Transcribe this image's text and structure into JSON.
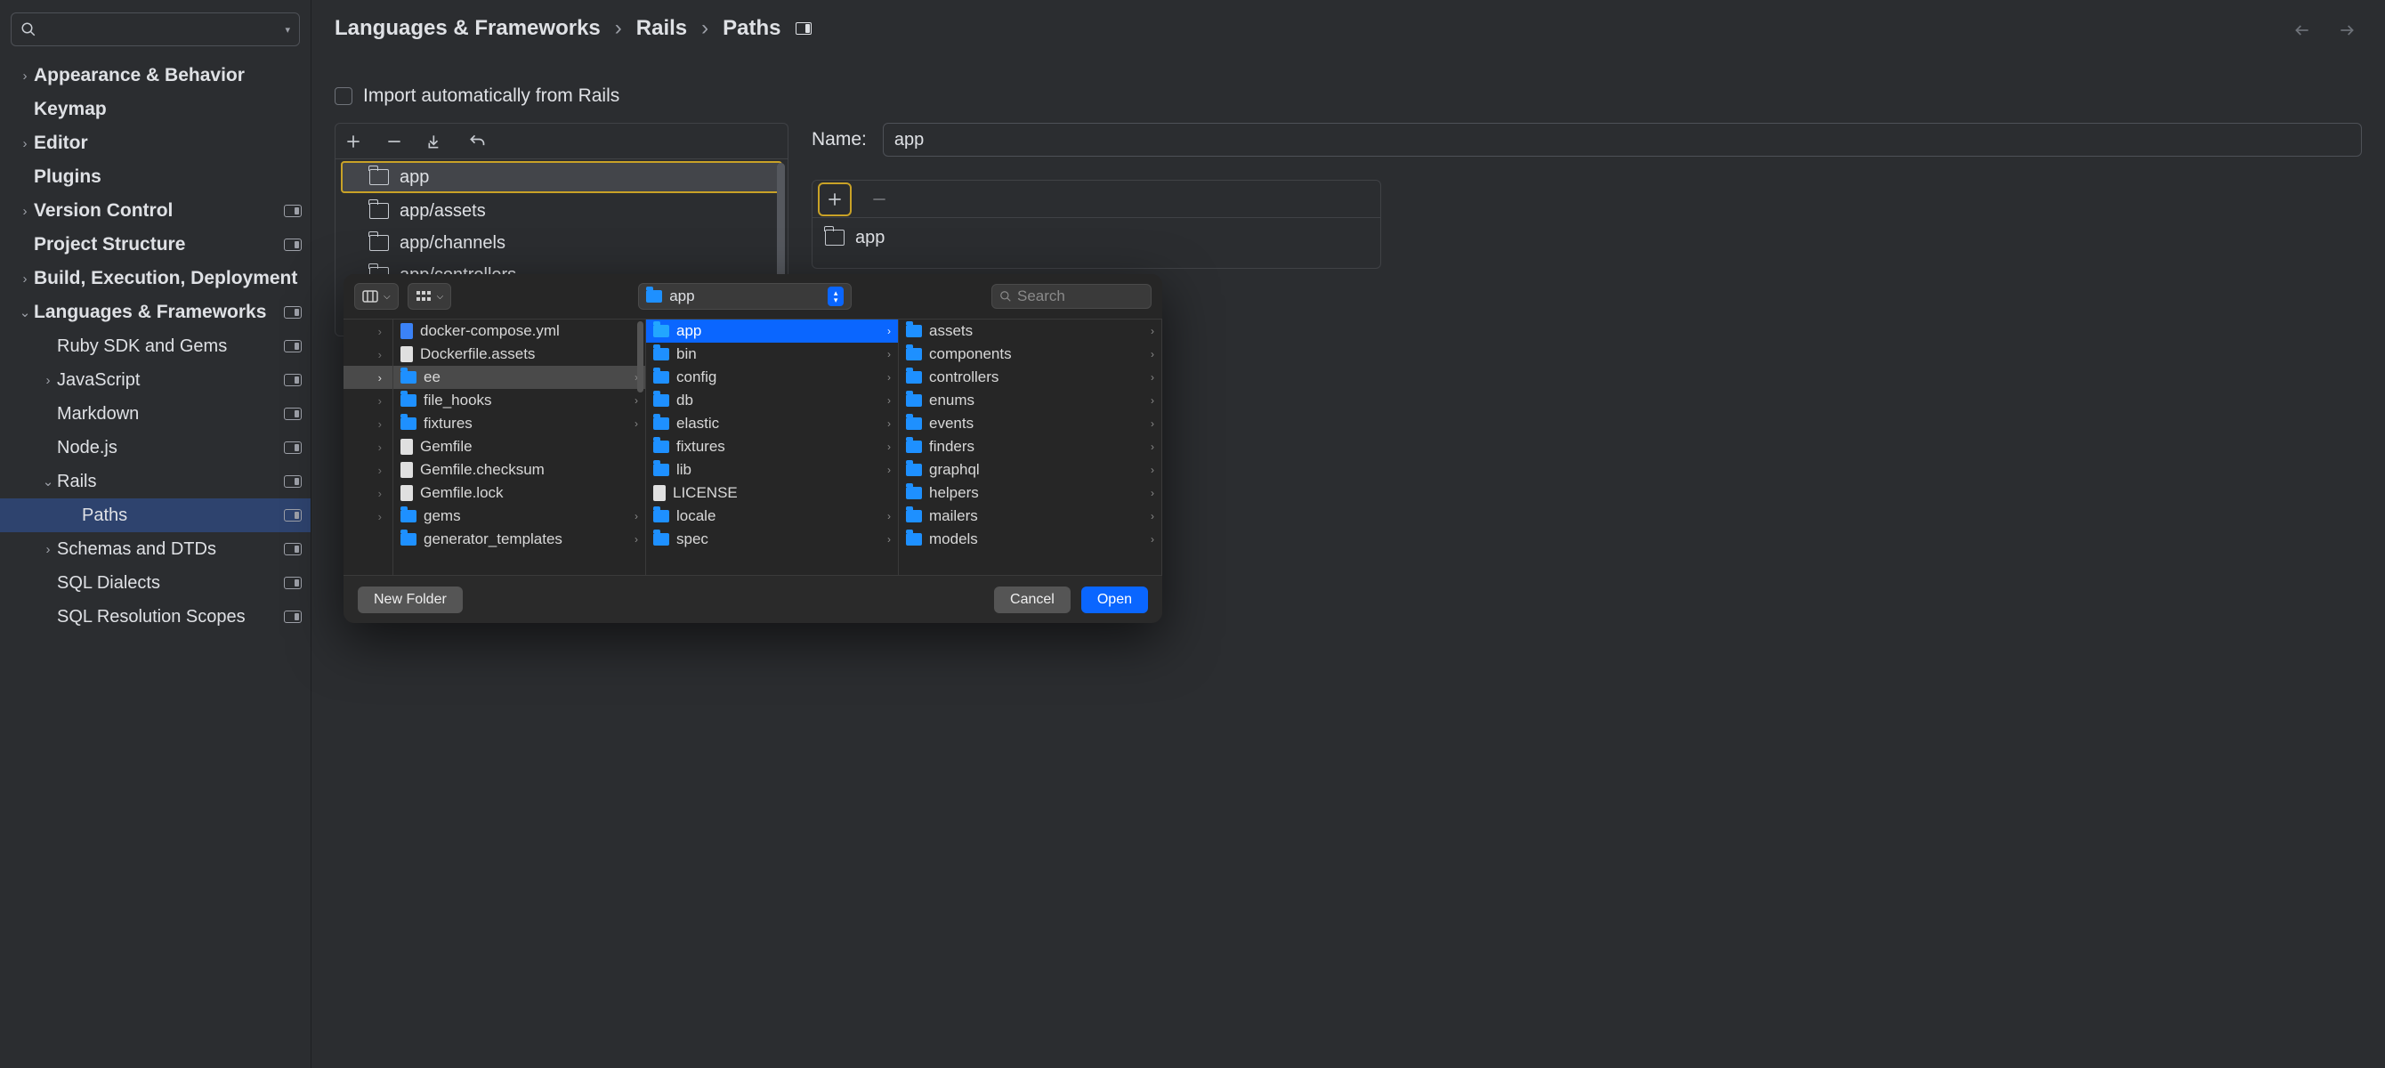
{
  "search": {
    "placeholder": ""
  },
  "sidebar": {
    "items": [
      {
        "label": "Appearance & Behavior",
        "indent": 0,
        "arrow": "right",
        "badge": false
      },
      {
        "label": "Keymap",
        "indent": 0,
        "arrow": "",
        "badge": false
      },
      {
        "label": "Editor",
        "indent": 0,
        "arrow": "right",
        "badge": false
      },
      {
        "label": "Plugins",
        "indent": 0,
        "arrow": "",
        "badge": false
      },
      {
        "label": "Version Control",
        "indent": 0,
        "arrow": "right",
        "badge": true
      },
      {
        "label": "Project Structure",
        "indent": 0,
        "arrow": "",
        "badge": true
      },
      {
        "label": "Build, Execution, Deployment",
        "indent": 0,
        "arrow": "right",
        "badge": false
      },
      {
        "label": "Languages & Frameworks",
        "indent": 0,
        "arrow": "down",
        "badge": true
      },
      {
        "label": "Ruby SDK and Gems",
        "indent": 1,
        "arrow": "",
        "badge": true
      },
      {
        "label": "JavaScript",
        "indent": 1,
        "arrow": "right",
        "badge": true
      },
      {
        "label": "Markdown",
        "indent": 1,
        "arrow": "",
        "badge": true
      },
      {
        "label": "Node.js",
        "indent": 1,
        "arrow": "",
        "badge": true
      },
      {
        "label": "Rails",
        "indent": 1,
        "arrow": "down",
        "badge": true
      },
      {
        "label": "Paths",
        "indent": 2,
        "arrow": "",
        "badge": true,
        "selected": true
      },
      {
        "label": "Schemas and DTDs",
        "indent": 1,
        "arrow": "right",
        "badge": true
      },
      {
        "label": "SQL Dialects",
        "indent": 1,
        "arrow": "",
        "badge": true
      },
      {
        "label": "SQL Resolution Scopes",
        "indent": 1,
        "arrow": "",
        "badge": true
      }
    ]
  },
  "breadcrumb": {
    "a": "Languages & Frameworks",
    "b": "Rails",
    "c": "Paths"
  },
  "import_checkbox_label": "Import automatically from Rails",
  "path_list": [
    {
      "name": "app",
      "selected": true
    },
    {
      "name": "app/assets"
    },
    {
      "name": "app/channels"
    },
    {
      "name": "app/controllers"
    }
  ],
  "name_field": {
    "label": "Name:",
    "value": "app"
  },
  "sub_list": [
    {
      "name": "app"
    }
  ],
  "file_dialog": {
    "current": "app",
    "search_placeholder": "Search",
    "col1_rows": 9,
    "col1_selected_index": 2,
    "col2": [
      {
        "name": "docker-compose.yml",
        "type": "file-blue"
      },
      {
        "name": "Dockerfile.assets",
        "type": "file"
      },
      {
        "name": "ee",
        "type": "folder",
        "selected": "grey",
        "chev": true
      },
      {
        "name": "file_hooks",
        "type": "folder",
        "chev": true
      },
      {
        "name": "fixtures",
        "type": "folder",
        "chev": true
      },
      {
        "name": "Gemfile",
        "type": "file"
      },
      {
        "name": "Gemfile.checksum",
        "type": "file"
      },
      {
        "name": "Gemfile.lock",
        "type": "file"
      },
      {
        "name": "gems",
        "type": "folder",
        "chev": true
      },
      {
        "name": "generator_templates",
        "type": "folder",
        "chev": true
      }
    ],
    "col3": [
      {
        "name": "app",
        "type": "folder",
        "selected": "blue",
        "chev": true
      },
      {
        "name": "bin",
        "type": "folder",
        "chev": true
      },
      {
        "name": "config",
        "type": "folder",
        "chev": true
      },
      {
        "name": "db",
        "type": "folder",
        "chev": true
      },
      {
        "name": "elastic",
        "type": "folder",
        "chev": true
      },
      {
        "name": "fixtures",
        "type": "folder",
        "chev": true
      },
      {
        "name": "lib",
        "type": "folder",
        "chev": true
      },
      {
        "name": "LICENSE",
        "type": "file"
      },
      {
        "name": "locale",
        "type": "folder",
        "chev": true
      },
      {
        "name": "spec",
        "type": "folder",
        "chev": true
      }
    ],
    "col4": [
      {
        "name": "assets",
        "type": "folder",
        "chev": true
      },
      {
        "name": "components",
        "type": "folder",
        "chev": true
      },
      {
        "name": "controllers",
        "type": "folder",
        "chev": true
      },
      {
        "name": "enums",
        "type": "folder",
        "chev": true
      },
      {
        "name": "events",
        "type": "folder",
        "chev": true
      },
      {
        "name": "finders",
        "type": "folder",
        "chev": true
      },
      {
        "name": "graphql",
        "type": "folder",
        "chev": true
      },
      {
        "name": "helpers",
        "type": "folder",
        "chev": true
      },
      {
        "name": "mailers",
        "type": "folder",
        "chev": true
      },
      {
        "name": "models",
        "type": "folder",
        "chev": true
      }
    ],
    "buttons": {
      "new_folder": "New Folder",
      "cancel": "Cancel",
      "open": "Open"
    }
  }
}
